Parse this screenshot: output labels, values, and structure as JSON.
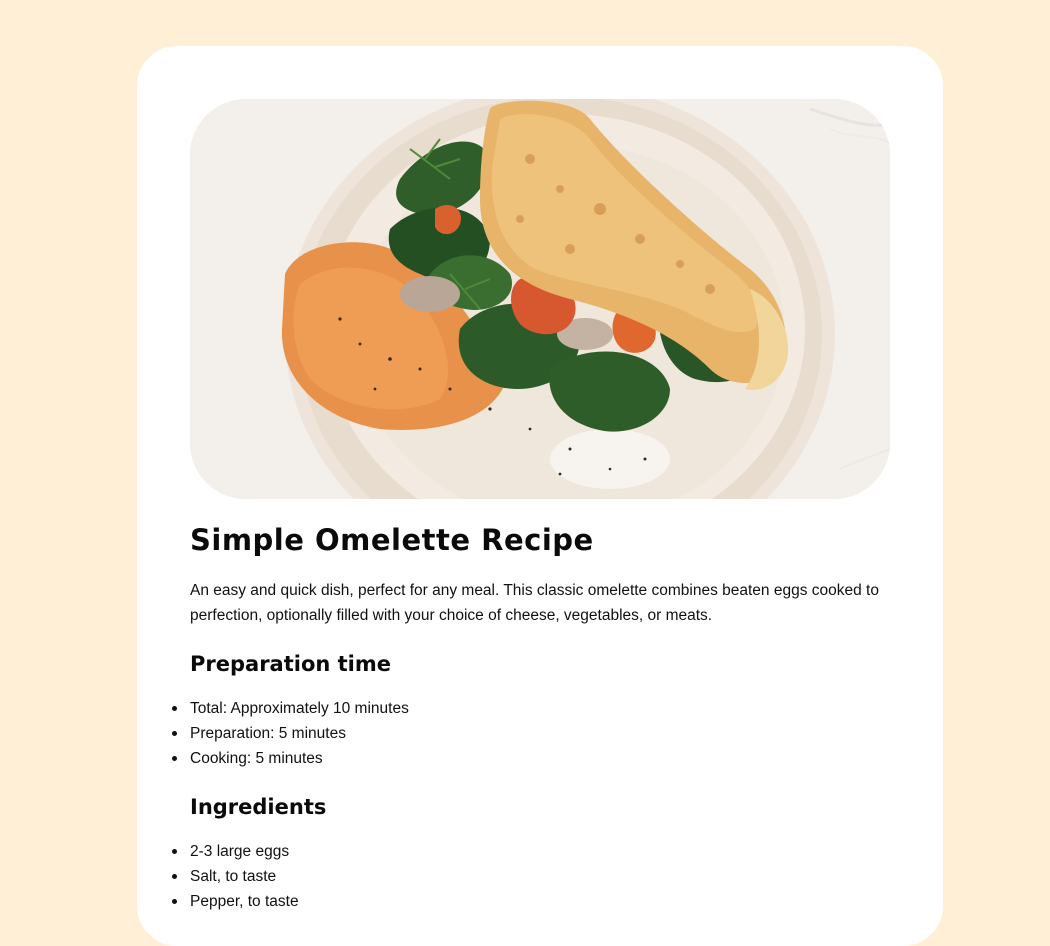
{
  "recipe": {
    "image_alt": "omelette-photo",
    "title": "Simple Omelette Recipe",
    "description": "An easy and quick dish, perfect for any meal. This classic omelette combines beaten eggs cooked to perfection, optionally filled with your choice of cheese, vegetables, or meats.",
    "prep": {
      "heading": "Preparation time",
      "items": [
        "Total: Approximately 10 minutes",
        "Preparation: 5 minutes",
        "Cooking: 5 minutes"
      ]
    },
    "ingredients": {
      "heading": "Ingredients",
      "items": [
        "2-3 large eggs",
        "Salt, to taste",
        "Pepper, to taste"
      ]
    }
  },
  "colors": {
    "page_background": "#FFEFD6",
    "card_background": "#FFFFFF",
    "text": "#111111"
  }
}
